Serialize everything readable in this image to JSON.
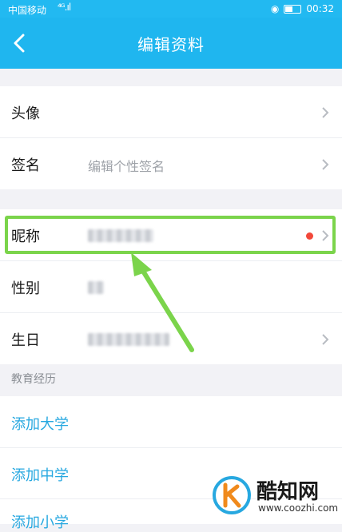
{
  "status_bar": {
    "carrier": "中国移动",
    "signal": "⁴ᴳ.ıl",
    "battery": "27",
    "time": "00:32"
  },
  "header": {
    "title": "编辑资料"
  },
  "profile": {
    "avatar_label": "头像",
    "signature_label": "签名",
    "signature_placeholder": "编辑个性签名"
  },
  "details": {
    "nickname_label": "昵称",
    "gender_label": "性别",
    "birthday_label": "生日"
  },
  "education": {
    "header": "教育经历",
    "add_university": "添加大学",
    "add_middle_school": "添加中学",
    "add_primary_school": "添加小学"
  },
  "watermark": {
    "name": "酷知网",
    "url": "www.coozhi.com"
  },
  "colors": {
    "header": "#1fb6ef",
    "link": "#27a8e0",
    "highlight": "#7bd44b",
    "red_dot": "#f2483a"
  }
}
